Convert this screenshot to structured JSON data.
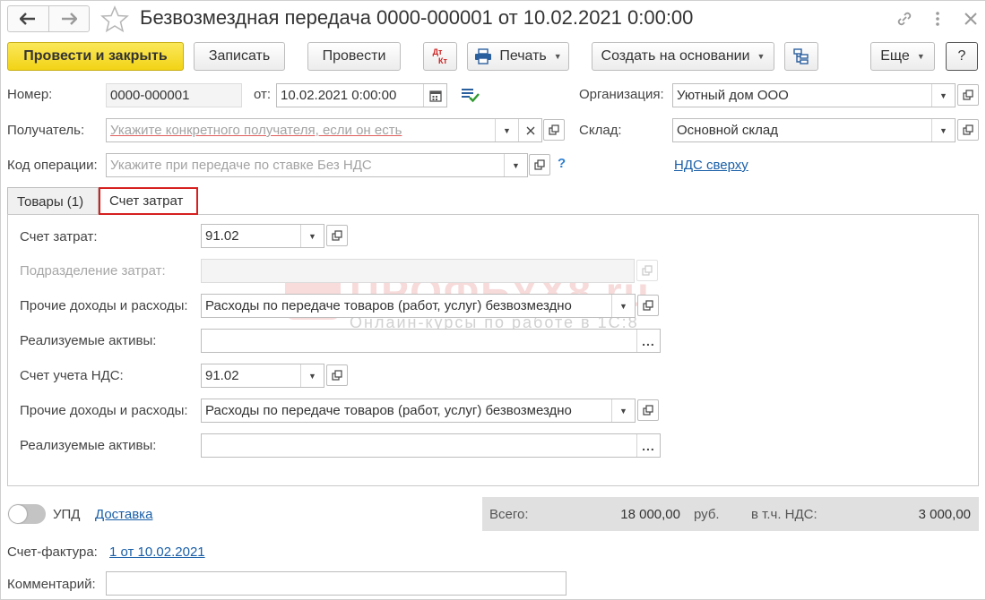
{
  "window": {
    "title": "Безвозмездная передача 0000-000001 от 10.02.2021 0:00:00"
  },
  "toolbar": {
    "post_close": "Провести и закрыть",
    "save": "Записать",
    "post": "Провести",
    "dt_kt_top": "Дт",
    "dt_kt_bottom": "Кт",
    "print": "Печать",
    "create_based": "Создать на основании",
    "more": "Еще",
    "help": "?"
  },
  "header": {
    "number_label": "Номер:",
    "number_value": "0000-000001",
    "date_label": "от:",
    "date_value": "10.02.2021  0:00:00",
    "org_label": "Организация:",
    "org_value": "Уютный дом ООО",
    "recipient_label": "Получатель:",
    "recipient_placeholder": "Укажите конкретного получателя, если он есть",
    "warehouse_label": "Склад:",
    "warehouse_value": "Основной склад",
    "opcode_label": "Код операции:",
    "opcode_placeholder": "Укажите при передаче по ставке Без НДС",
    "opcode_help": "?",
    "vat_link": "НДС сверху"
  },
  "tabs": [
    {
      "label": "Товары (1)",
      "active": false
    },
    {
      "label": "Счет затрат",
      "active": true
    }
  ],
  "cost_tab": {
    "cost_account_label": "Счет затрат:",
    "cost_account_value": "91.02",
    "cost_division_label": "Подразделение затрат:",
    "other_income_label_1": "Прочие доходы и расходы:",
    "other_income_value_1": "Расходы по передаче товаров (работ, услуг) безвозмездно",
    "assets_label_1": "Реализуемые активы:",
    "vat_account_label": "Счет учета НДС:",
    "vat_account_value": "91.02",
    "other_income_label_2": "Прочие доходы и расходы:",
    "other_income_value_2": "Расходы по передаче товаров (работ, услуг) безвозмездно",
    "assets_label_2": "Реализуемые активы:",
    "dots": "..."
  },
  "watermark": {
    "text": "ПРОФБУХ8.ru",
    "subtext": "Онлайн-курсы по работе в 1С:8"
  },
  "footer": {
    "upd_label": "УПД",
    "delivery_link": "Доставка",
    "total_label": "Всего:",
    "total_value": "18 000,00",
    "currency": "руб.",
    "vat_label": "в т.ч. НДС:",
    "vat_value": "3 000,00",
    "invoice_label": "Счет-фактура:",
    "invoice_link": "1 от 10.02.2021",
    "comment_label": "Комментарий:",
    "comment_value": ""
  },
  "colors": {
    "primary_button": "#f5d81e",
    "active_tab_border": "#d62020",
    "link": "#1a5fa8"
  }
}
